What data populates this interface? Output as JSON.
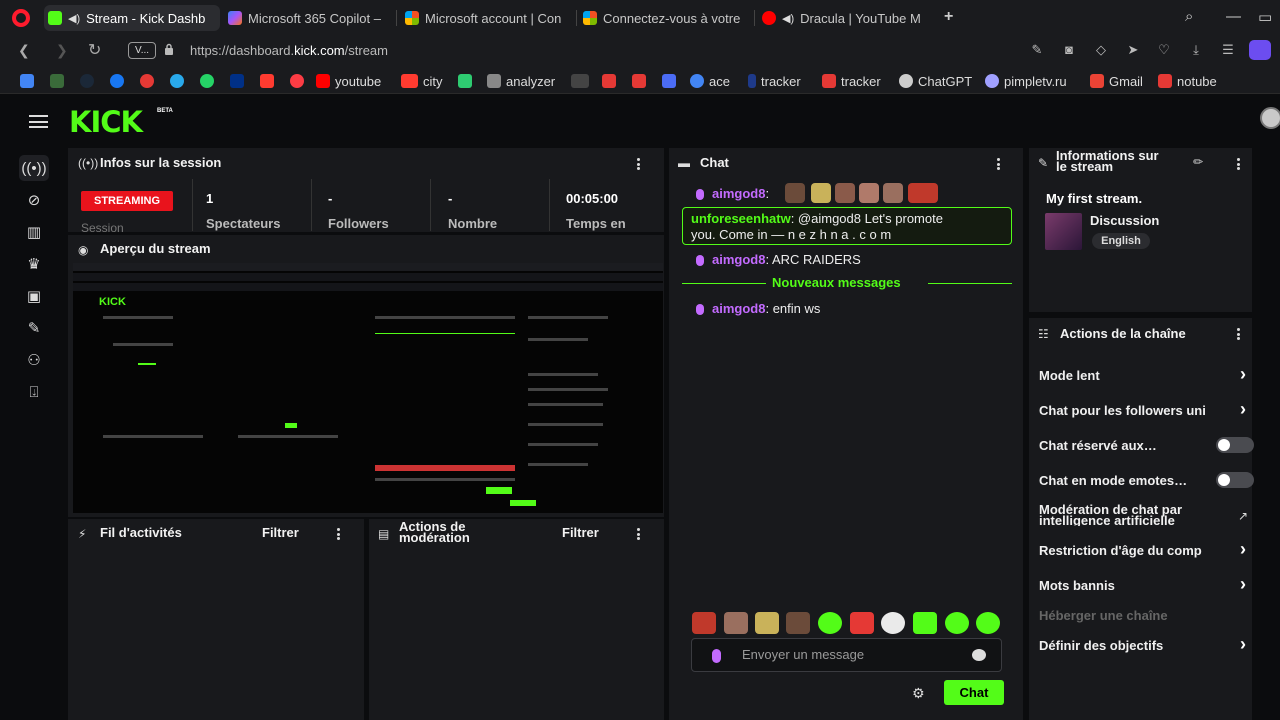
{
  "browser": {
    "tabs": [
      {
        "title": "Stream - Kick Dashb",
        "active": true
      },
      {
        "title": "Microsoft 365 Copilot –"
      },
      {
        "title": "Microsoft account | Con"
      },
      {
        "title": "Connectez-vous à votre"
      },
      {
        "title": "Dracula | YouTube M"
      }
    ],
    "vpn_label": "V...",
    "url_prefix": "https://dashboard.",
    "url_domain": "kick.com",
    "url_path": "/stream",
    "bookmarks": [
      "youtube",
      "city",
      "analyzer",
      "ace",
      "tracker",
      "tracker",
      "ChatGPT",
      "pimpletv.ru",
      "Gmail",
      "notube"
    ]
  },
  "kick": {
    "logo": "KICK",
    "beta": "BETA",
    "session": {
      "title": "Infos sur la session",
      "status": "STREAMING",
      "status_sub": "Session",
      "stats": [
        {
          "value": "1",
          "label": "Spectateurs"
        },
        {
          "value": "-",
          "label": "Followers"
        },
        {
          "value": "-",
          "label": "Nombre"
        },
        {
          "value": "00:05:00",
          "label": "Temps en"
        }
      ]
    },
    "preview": {
      "title": "Aperçu du stream"
    },
    "activity": {
      "title": "Fil d'activités",
      "filter": "Filtrer"
    },
    "moderation": {
      "title_line1": "Actions de",
      "title_line2": "modération",
      "filter": "Filtrer"
    },
    "chat": {
      "title": "Chat",
      "messages": [
        {
          "user": "aimgod8",
          "text": ""
        },
        {
          "user": "unforeseenhatw",
          "text": "@aimgod8 Let's promote",
          "text2": "you. Come in — n e z h n a . c o m"
        },
        {
          "user": "aimgod8",
          "text": "ARC RAIDERS"
        },
        {
          "user": "aimgod8",
          "text": "enfin ws"
        }
      ],
      "new_messages": "Nouveaux messages",
      "input_placeholder": "Envoyer un message",
      "send_label": "Chat"
    },
    "stream_info": {
      "title_line1": "Informations sur",
      "title_line2": "le stream",
      "stream_title": "My first stream.",
      "category": "Discussion",
      "language": "English"
    },
    "channel_actions": {
      "title": "Actions de la chaîne",
      "items": [
        {
          "label": "Mode lent",
          "control": "chevron"
        },
        {
          "label": "Chat pour les followers uni",
          "control": "chevron"
        },
        {
          "label": "Chat réservé aux…",
          "control": "toggle"
        },
        {
          "label": "Chat en mode emotes…",
          "control": "toggle"
        },
        {
          "label": "Modération de chat par",
          "label2": "intelligence artificielle",
          "control": "external"
        },
        {
          "label": "Restriction d'âge du comp",
          "control": "chevron"
        },
        {
          "label": "Mots bannis",
          "control": "chevron"
        },
        {
          "label": "Héberger une chaîne",
          "control": "none",
          "disabled": true
        },
        {
          "label": "Définir des objectifs",
          "control": "chevron"
        }
      ]
    },
    "colors": {
      "accent": "#53fc18",
      "live": "#e9131c",
      "chat_user": "#c36bff"
    }
  }
}
